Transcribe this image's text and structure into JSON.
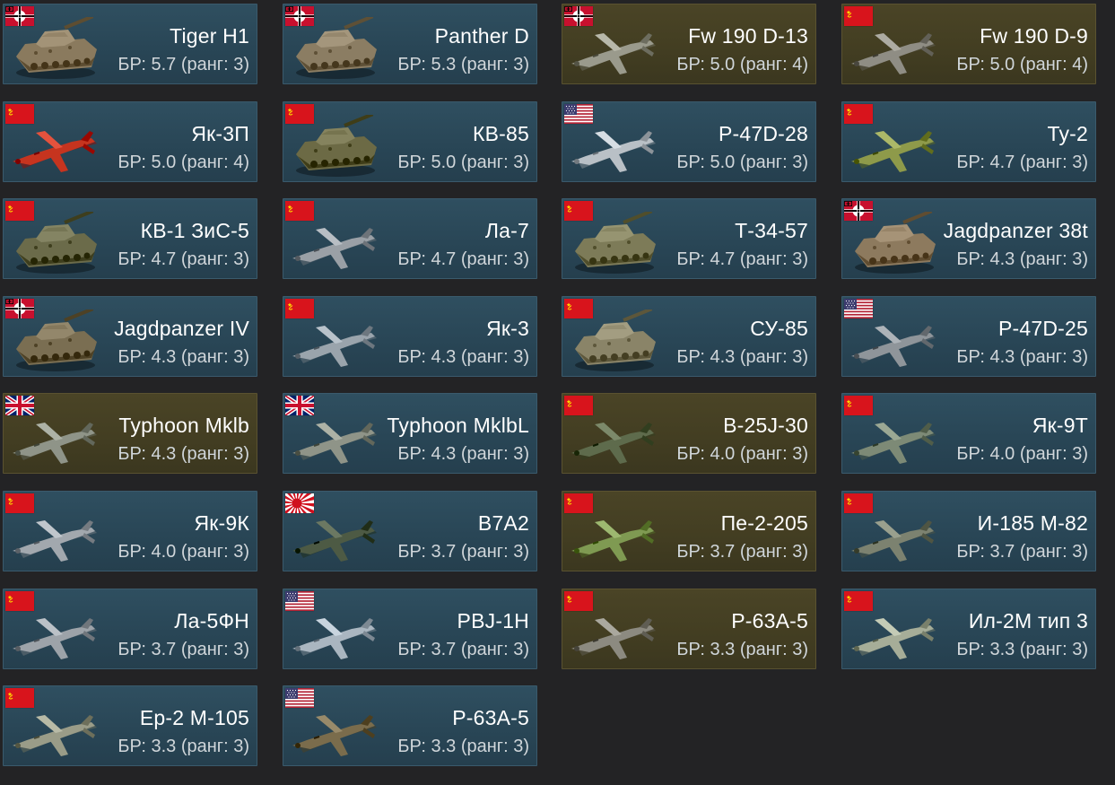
{
  "colors": {
    "background": "#232325",
    "card_standard": "#294656",
    "card_premium": "#433e22",
    "name_text": "#ffffff",
    "br_text": "#d0d6da"
  },
  "vehicles": [
    {
      "name": "Tiger H1",
      "br": "БР: 5.7 (ранг: 3)",
      "nation": "germany",
      "type": "tank",
      "premium": false,
      "color": "#8a7a5e"
    },
    {
      "name": "Panther D",
      "br": "БР: 5.3 (ранг: 3)",
      "nation": "germany",
      "type": "tank",
      "premium": false,
      "color": "#8b7d63"
    },
    {
      "name": "Fw 190 D-13",
      "br": "БР: 5.0 (ранг: 4)",
      "nation": "germany",
      "type": "plane",
      "premium": true,
      "color": "#9a9a8c"
    },
    {
      "name": "Fw 190 D-9",
      "br": "БР: 5.0 (ранг: 4)",
      "nation": "ussr",
      "type": "plane",
      "premium": true,
      "color": "#8f8d84"
    },
    {
      "name": "Як-3П",
      "br": "БР: 5.0 (ранг: 4)",
      "nation": "ussr",
      "type": "plane",
      "premium": false,
      "color": "#c6341f"
    },
    {
      "name": "КВ-85",
      "br": "БР: 5.0 (ранг: 3)",
      "nation": "ussr",
      "type": "tank",
      "premium": false,
      "color": "#6c6a45"
    },
    {
      "name": "P-47D-28",
      "br": "БР: 5.0 (ранг: 3)",
      "nation": "usa",
      "type": "plane",
      "premium": false,
      "color": "#b9c0c6"
    },
    {
      "name": "Ту-2",
      "br": "БР: 4.7 (ранг: 3)",
      "nation": "ussr",
      "type": "plane",
      "premium": false,
      "color": "#8e9a4a"
    },
    {
      "name": "КВ-1 ЗиС-5",
      "br": "БР: 4.7 (ранг: 3)",
      "nation": "ussr",
      "type": "tank",
      "premium": false,
      "color": "#6b6b4a"
    },
    {
      "name": "Ла-7",
      "br": "БР: 4.7 (ранг: 3)",
      "nation": "ussr",
      "type": "plane",
      "premium": false,
      "color": "#9aa0a6"
    },
    {
      "name": "Т-34-57",
      "br": "БР: 4.7 (ранг: 3)",
      "nation": "ussr",
      "type": "tank",
      "premium": false,
      "color": "#7d7b58"
    },
    {
      "name": "Jagdpanzer 38t",
      "br": "БР: 4.3 (ранг: 3)",
      "nation": "germany",
      "type": "tank",
      "premium": false,
      "color": "#8d7a5e"
    },
    {
      "name": "Jagdpanzer IV",
      "br": "БР: 4.3 (ранг: 3)",
      "nation": "germany",
      "type": "tank",
      "premium": false,
      "color": "#7a6e52"
    },
    {
      "name": "Як-3",
      "br": "БР: 4.3 (ранг: 3)",
      "nation": "ussr",
      "type": "plane",
      "premium": false,
      "color": "#9aa4ac"
    },
    {
      "name": "СУ-85",
      "br": "БР: 4.3 (ранг: 3)",
      "nation": "ussr",
      "type": "tank",
      "premium": false,
      "color": "#8a8468"
    },
    {
      "name": "P-47D-25",
      "br": "БР: 4.3 (ранг: 3)",
      "nation": "usa",
      "type": "plane",
      "premium": false,
      "color": "#8f959a"
    },
    {
      "name": "Typhoon Mklb",
      "br": "БР: 4.3 (ранг: 3)",
      "nation": "uk",
      "type": "plane",
      "premium": true,
      "color": "#8f9488"
    },
    {
      "name": "Typhoon MklbL",
      "br": "БР: 4.3 (ранг: 3)",
      "nation": "uk",
      "type": "plane",
      "premium": false,
      "color": "#8f9488"
    },
    {
      "name": "B-25J-30",
      "br": "БР: 4.0 (ранг: 3)",
      "nation": "ussr",
      "type": "plane",
      "premium": true,
      "color": "#5e6b4c"
    },
    {
      "name": "Як-9Т",
      "br": "БР: 4.0 (ранг: 3)",
      "nation": "ussr",
      "type": "plane",
      "premium": false,
      "color": "#7d8a76"
    },
    {
      "name": "Як-9К",
      "br": "БР: 4.0 (ранг: 3)",
      "nation": "ussr",
      "type": "plane",
      "premium": false,
      "color": "#a2a8ae"
    },
    {
      "name": "B7A2",
      "br": "БР: 3.7 (ранг: 3)",
      "nation": "japan",
      "type": "plane",
      "premium": false,
      "color": "#4d5a44"
    },
    {
      "name": "Пе-2-205",
      "br": "БР: 3.7 (ранг: 3)",
      "nation": "ussr",
      "type": "plane",
      "premium": true,
      "color": "#7f9a52"
    },
    {
      "name": "И-185 М-82",
      "br": "БР: 3.7 (ранг: 3)",
      "nation": "ussr",
      "type": "plane",
      "premium": false,
      "color": "#7c8270"
    },
    {
      "name": "Ла-5ФН",
      "br": "БР: 3.7 (ранг: 3)",
      "nation": "ussr",
      "type": "plane",
      "premium": false,
      "color": "#9da3a9"
    },
    {
      "name": "PBJ-1H",
      "br": "БР: 3.7 (ранг: 3)",
      "nation": "usa",
      "type": "plane",
      "premium": false,
      "color": "#aab6c0"
    },
    {
      "name": "P-63A-5",
      "br": "БР: 3.3 (ранг: 3)",
      "nation": "ussr",
      "type": "plane",
      "premium": true,
      "color": "#8c8a80"
    },
    {
      "name": "Ил-2М тип 3",
      "br": "БР: 3.3 (ранг: 3)",
      "nation": "ussr",
      "type": "plane",
      "premium": false,
      "color": "#a6ad98"
    },
    {
      "name": "Ер-2 М-105",
      "br": "БР: 3.3 (ранг: 3)",
      "nation": "ussr",
      "type": "plane",
      "premium": false,
      "color": "#9a9c88"
    },
    {
      "name": "P-63A-5",
      "br": "БР: 3.3 (ранг: 3)",
      "nation": "usa",
      "type": "plane",
      "premium": false,
      "color": "#7a6c4c"
    }
  ]
}
